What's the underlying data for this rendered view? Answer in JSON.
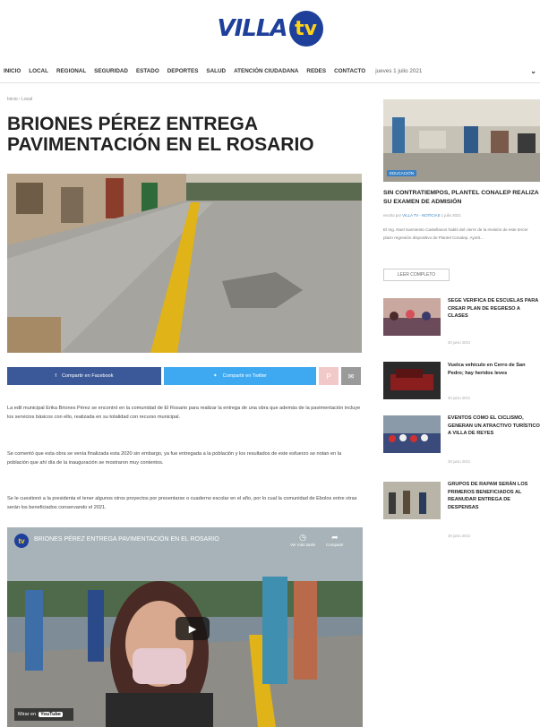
{
  "site": {
    "logo_text": "VILLA",
    "logo_badge": "tv"
  },
  "nav": {
    "items": [
      "INICIO",
      "LOCAL",
      "REGIONAL",
      "SEGURIDAD",
      "ESTADO",
      "DEPORTES",
      "SALUD",
      "ATENCIÓN CIUDADANA",
      "REDES",
      "CONTACTO"
    ],
    "date": "jueves 1 julio 2021"
  },
  "article": {
    "breadcrumb": "Inicio › Local",
    "title": "BRIONES PÉREZ ENTREGA PAVIMENTACIÓN EN EL ROSARIO",
    "share": {
      "facebook": "Compartir en Facebook",
      "twitter": "Compartir en Twitter"
    },
    "paragraphs": [
      "La edil municipal Erika Briones Pérez se encontró en la comunidad de El Rosario para realizar la entrega de una obra que además de la pavimentación incluye los servicios básicos con ello, realizada en su totalidad con recurso municipal.",
      "Se comentó que esta obra se venía finalizada esta 2020 sin embargo, ya fue entregada a la población y los resultados de este esfuerzo se notan en la población que ahí día de la inauguración se mostraron muy contentos.",
      "Se le cuestionó a la presidenta el tener algunos otros proyectos por presentarse o cuaderno escolar en el año, por lo cual la comunidad de Ebolos entre otras serán los beneficiados conservando el 2021."
    ],
    "video": {
      "title": "BRIONES PÉREZ ENTREGA PAVIMENTACIÓN EN EL ROSARIO",
      "watch_later": "Ver más tarde",
      "share": "Compartir",
      "watch_on": "Mirar en",
      "youtube": "YouTube"
    }
  },
  "sidebar": {
    "featured": {
      "badge": "EDUCACIÓN",
      "title": "SIN CONTRATIEMPOS, PLANTEL CONALEP REALIZA SU EXAMEN DE ADMISIÓN",
      "meta_prefix": "escrito por",
      "author": "VILLA TV - NOTICIAS",
      "date": "1 julio 2021",
      "excerpt": "El Ing. Noel Sarmiento Castellanos habló del cierre de la revisión de este tercer plazo regresión dispositivo de Plantel Conalep. Ayotit...",
      "read_more": "LEER COMPLETO"
    },
    "items": [
      {
        "title": "SEGE VERIFICA DE ESCUELAS PARA CREAR PLAN DE REGRESO A CLASES",
        "date": "30 junio 2021"
      },
      {
        "title": "Vuelca vehículo en Cerro de San Pedro; hay heridos leves",
        "date": "30 junio 2021"
      },
      {
        "title": "EVENTOS COMO EL CICLISMO, GENERAN UN ATRACTIVO TURÍSTICO A VILLA DE REYES",
        "date": "29 junio 2021"
      },
      {
        "title": "GRUPOS DE RAPAM SERÁN LOS PRIMEROS BENEFICIADOS AL REANUDAR ENTREGA DE DESPENSAS",
        "date": "29 junio 2021"
      }
    ]
  }
}
